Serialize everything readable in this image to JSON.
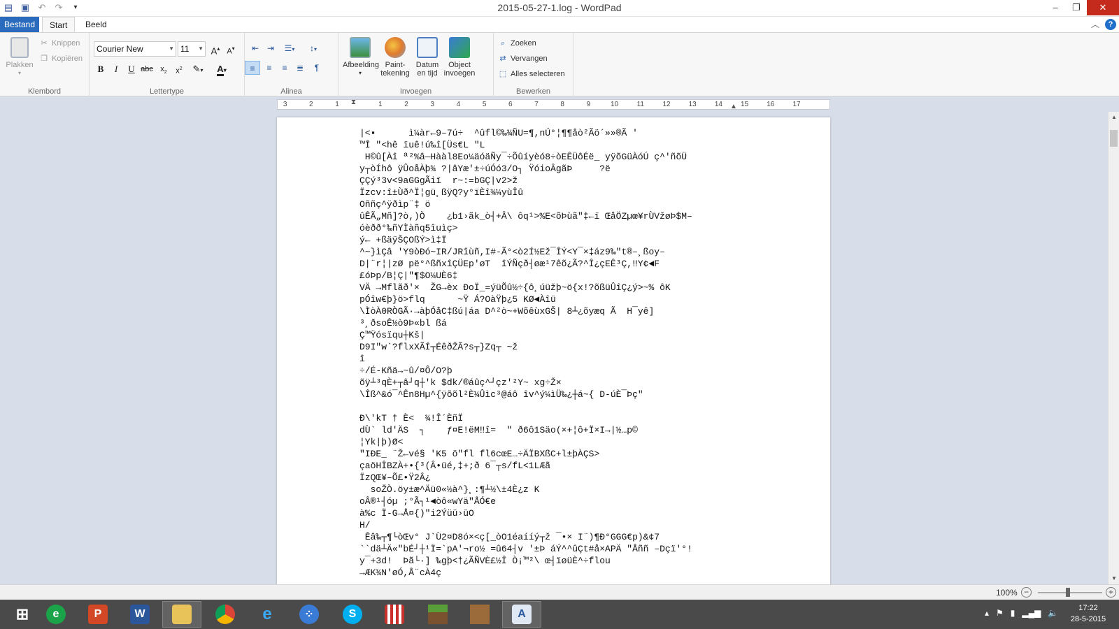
{
  "window": {
    "title": "2015-05-27-1.log - WordPad"
  },
  "qat": {
    "icons": [
      "wordpad-icon",
      "save-icon",
      "undo-icon",
      "redo-icon",
      "customize-icon"
    ]
  },
  "tabs": {
    "file": "Bestand",
    "start": "Start",
    "view": "Beeld"
  },
  "ribbon": {
    "clipboard": {
      "label": "Klembord",
      "paste": "Plakken",
      "cut": "Knippen",
      "copy": "Kopiëren"
    },
    "font": {
      "label": "Lettertype",
      "family": "Courier New",
      "size": "11"
    },
    "paragraph": {
      "label": "Alinea"
    },
    "insert": {
      "label": "Invoegen",
      "picture": "Afbeelding",
      "paint_1": "Paint-",
      "paint_2": "tekening",
      "datetime_1": "Datum",
      "datetime_2": "en tijd",
      "object_1": "Object",
      "object_2": "invoegen"
    },
    "edit": {
      "label": "Bewerken",
      "find": "Zoeken",
      "replace": "Vervangen",
      "select_all": "Alles selecteren"
    }
  },
  "ruler": {
    "marks": [
      "3",
      "2",
      "1",
      "1",
      "2",
      "3",
      "4",
      "5",
      "6",
      "7",
      "8",
      "9",
      "10",
      "11",
      "12",
      "13",
      "14",
      "15",
      "16",
      "17"
    ]
  },
  "document": {
    "lines": [
      "|<▪      ì¼àr←9–7ú÷  ^ûfl©‰¾ÑU=¶,nÚ°¦¶¶åò²Ãö´»»®Ã ʹ",
      "™Î \"<hê ïuê!ú‰î[Üs€L \"L",
      " H©û[Àî ª²%â—Hààl8Eo¼äóäÑy¯÷Õûíyèó8÷òEÊÜôÉë_ yÿõGüÀóÚ ç^'ñõÜ",
      "y┬òÍhô ÿÛoåÀþ¾ ?|âYæ'±÷úÓó3/O┐ ŸóioÂgãÞ     ?ë",
      "ÇÇý³3v<9aGGgÃiï  r~:=bGÇ|v2>ž",
      "Ïzcv:î±Ùð^Ï¦gü¸ßÿQ?y°ïÈî¾¼yùÎû",
      "Oññç^ÿðìp¨‡ ö",
      "ûÊÃ„Mñ]?ò,)Ò    ¿b1›ãk_ò┤+Â\\ ôq¹>%E<õÞùã\"‡←ï ŒåÖZµœ¥rÙVžøÞ$M–",
      "óèðð°‰ñYÌàñq5îuìç>",
      "ý← +ßäÿŠÇOßÝ>ì‡Ï",
      "^~}ìÇâ ʹY9òÐó~IR/JRîùñ,I#-Ã°<ò2Í½Ež¯ÎÝ<Y¯×‡áz9‰\"t®–¸ßoy–",
      "D|¨r¦|zØ pë°^ßñxîÇÜEp'øT  îÝÑçð┤øæ¹7êõ¿Ã?^Î¿çEÊ³Ç,‼Y¢◄F",
      "£óÞp/B¦Ç|\"¶$O¼UÈ6‡",
      "VÄ →Mflãð'×  ŽG→èx ÐoÏ_=ýüÕû½÷{ô¸úüžþ~ö{x!?õßüÛîÇ¿ý>~% ôK",
      "pÓîw€þ}ö>flq      ~Ÿ Á?OàŸþ¿5 KØ◄Àîü",
      "\\ÌòÀ0RÒGÃ·→àþÓåC‡ßú|áa D^²ò~+WõêùxGŠ| 8┴¿õyæq Ã  H¯yê]",
      "³¸ðsoÊ½ò9Þ«bl ßá",
      "Ç™Ÿósïqu┼Kš|",
      "D9I\"w`?flxXÃÍ┬ÉêðŽÃ?s┬}Zq┬ ~ž",
      "î",
      "÷/É-Kñä→~û/¤Ô/O?þ",
      "õÿ┴³qÈ+┬â┘q┼'k $dk/®áûç^┘çz'²Y~ xg÷Ž×",
      "\\Îß^&ó¯^Ên8Hµ^{ÿõõl²È¼Ûìc³@áô îv^ý¼ìÜ‰¿┼á~{ D-úÈ¯Þç\"",
      "",
      "Ð\\'kT † È<  ¾!Î´ÈñÏ",
      "dÙ` ld'ÄS  ┐    ƒ¤E!ëM‼î=  \" ð6ô1Säo(×+¦ô+Ï×I→|½…p©",
      "¦Yk|þ)Ø<",
      "\"IÐE_ ¨Ž←vé§ ʹK5 ö\"fl fl6cœE…÷ÄÏBXßC+l±þÀÇS>",
      "çaöHÎBZÀ+•{³(Â•üé,‡+;ð 6¯┬s/fL<1LÆã",
      "ÏzQŒ¥–Õ£•Ÿ2Â¿",
      "  soŽÒ.öy±æ^Äü0«½à^}¸:¶┴½\\±4È¿z K",
      "oÂ®¹┤óµ ;°Ã┐¹◄òô«wYä\"ÅÓ€e",
      "à%c Ï-G→Å¤{)\"i2Ýüü›üO",
      "H/",
      " Êâ‰┬¶└òŒv° J`Ù2¤D8ó×<ç[_òO1éaííý┬ž ¯•× I¨)¶Ð°GGG€p)&¢7",
      "``dä┴Ä«\"bÉ┘┼¹Ï=`pA'¬ro½ =û64┤v '±Þ áÝ^^ûÇt#å×APÄ \"Åññ –Dçï'°!",
      "y¯+3d!  Þã└·] ‰gþ<†¿ÃÑVÈ£½Î Ò¡™²\\ œ┤ïøüÈ^÷flou",
      "→ÆK¾N'øÓ,Å¨cÀ4ç"
    ]
  },
  "statusbar": {
    "zoom": "100%",
    "zoom_level": 0.5
  },
  "taskbar": {
    "apps": [
      "start-icon",
      "ie-metro-icon",
      "powerpoint-icon",
      "word-icon",
      "file-explorer-icon",
      "chrome-icon",
      "internet-explorer-icon",
      "app-circles-icon",
      "skype-icon",
      "popcorn-icon",
      "minecraft-icon",
      "crafting-table-icon",
      "wordpad-icon"
    ],
    "time": "17:22",
    "date": "28-5-2015"
  }
}
